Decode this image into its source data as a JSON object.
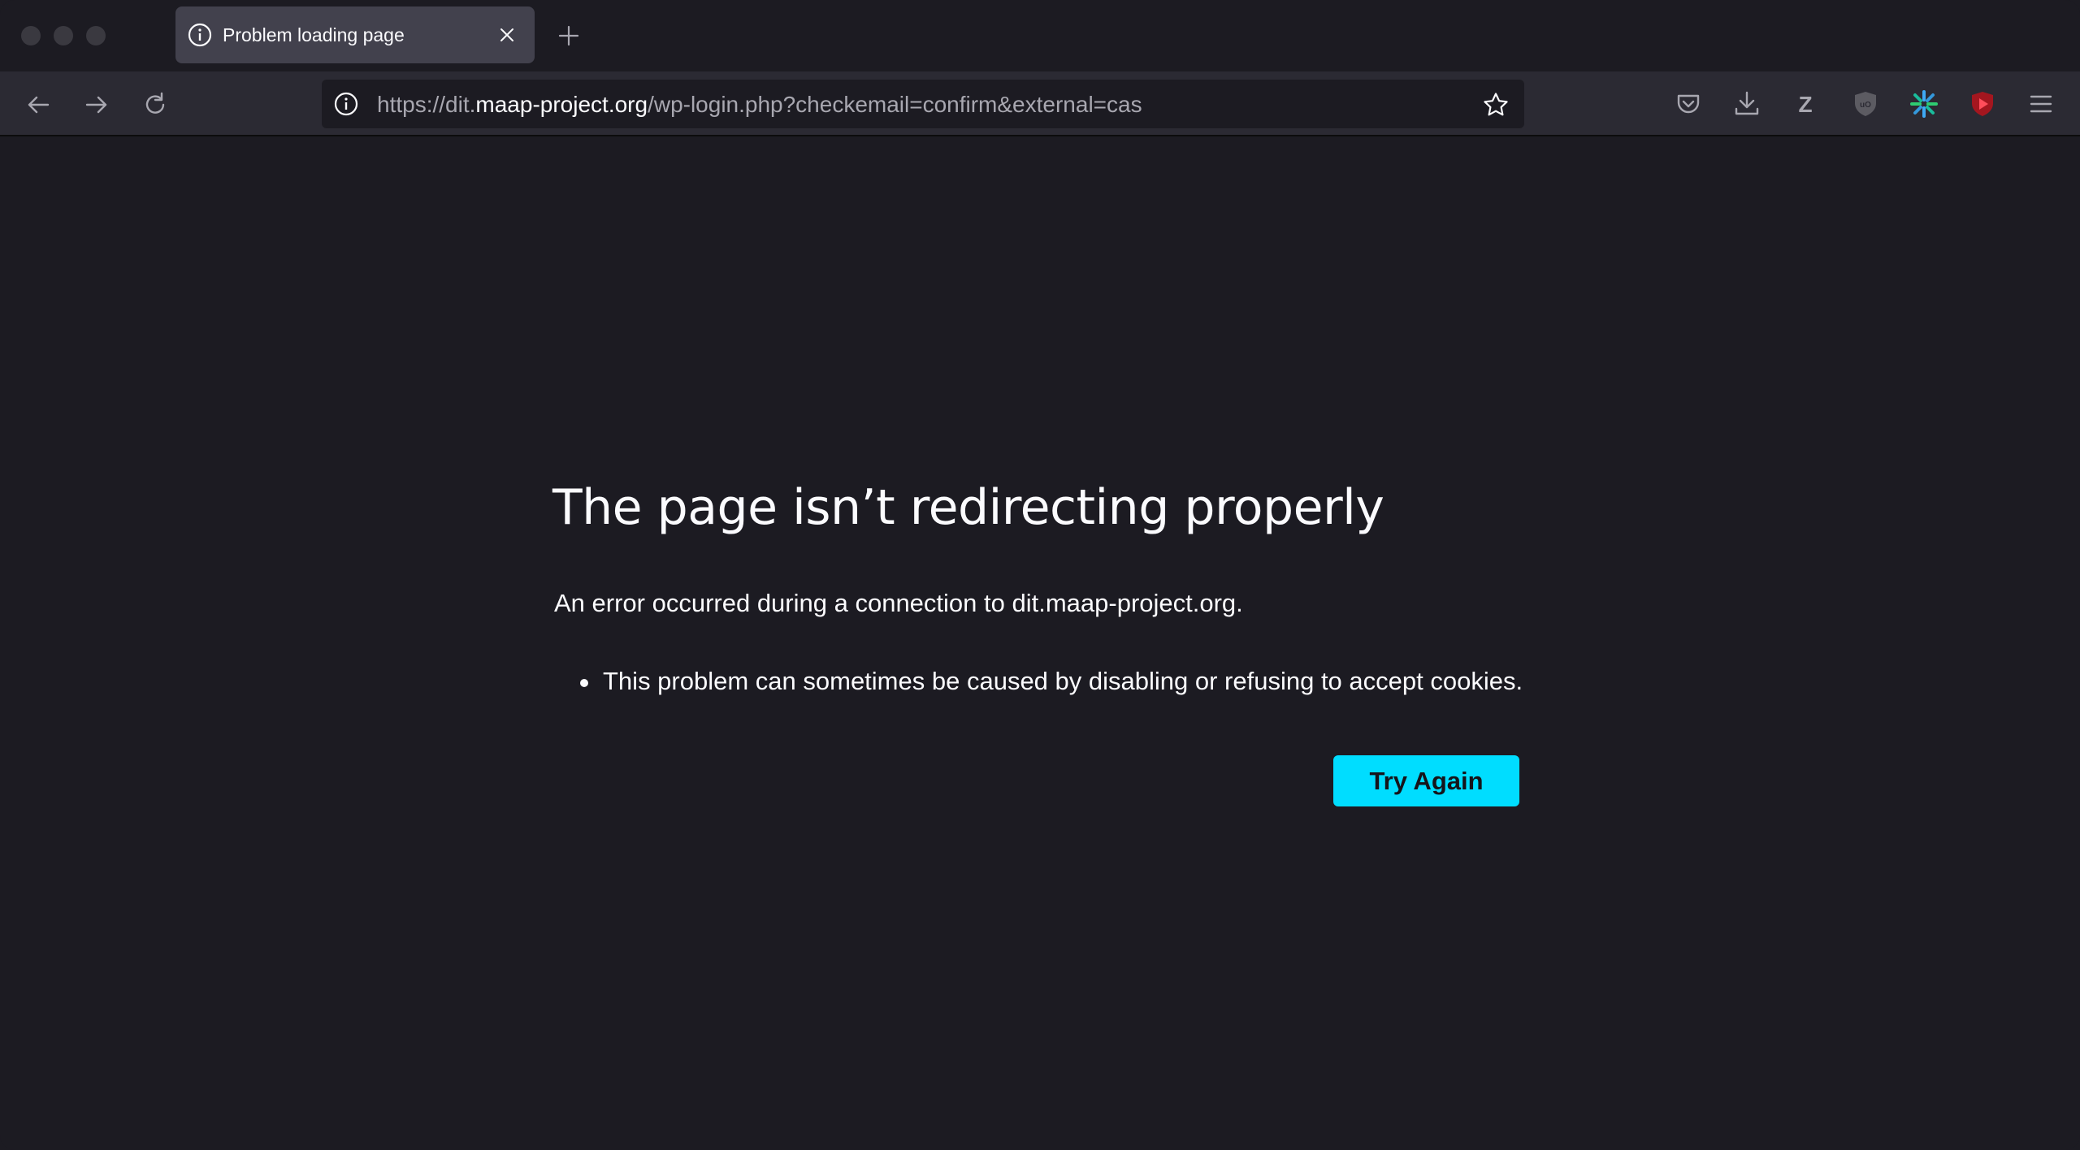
{
  "window": {
    "traffic_lights": [
      "close",
      "minimize",
      "zoom"
    ]
  },
  "tab": {
    "title": "Problem loading page",
    "icon": "info-icon",
    "close_icon": "close-icon"
  },
  "newtab": {
    "icon": "plus-icon"
  },
  "nav": {
    "back_icon": "back-arrow-icon",
    "forward_icon": "forward-arrow-icon",
    "reload_icon": "reload-icon"
  },
  "urlbar": {
    "prefix": "https://dit.",
    "host": "maap-project.org",
    "path": "/wp-login.php?checkemail=confirm&external=cas",
    "site_info_icon": "info-icon",
    "bookmark_icon": "star-icon"
  },
  "toolbar": {
    "icons": [
      "pocket-icon",
      "download-icon",
      "zotero-icon",
      "ublock-icon",
      "asterisk-extension-icon",
      "video-extension-icon",
      "menu-icon"
    ],
    "zotero_letter": "Z"
  },
  "error": {
    "title": "The page isn’t redirecting properly",
    "description": "An error occurred during a connection to dit.maap-project.org.",
    "bullets": [
      "This problem can sometimes be caused by disabling or refusing to accept cookies."
    ],
    "button_label": "Try Again"
  },
  "colors": {
    "background": "#1c1b22",
    "toolbar": "#2b2a33",
    "tab_selected": "#42414d",
    "accent_button": "#00ddff"
  }
}
